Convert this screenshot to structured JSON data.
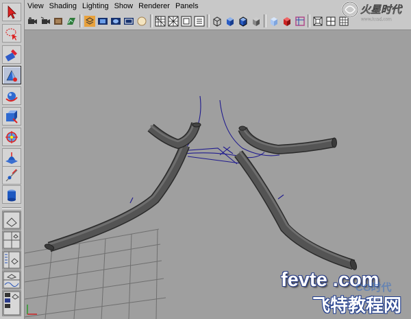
{
  "menu": {
    "items": [
      {
        "label": "View"
      },
      {
        "label": "Shading"
      },
      {
        "label": "Lighting"
      },
      {
        "label": "Show"
      },
      {
        "label": "Renderer"
      },
      {
        "label": "Panels"
      }
    ]
  },
  "toolbox": {
    "tools": [
      {
        "name": "select-tool-icon",
        "active": false
      },
      {
        "name": "lasso-tool-icon",
        "active": false
      },
      {
        "name": "paint-select-tool-icon",
        "active": false
      },
      {
        "name": "move-tool-icon",
        "active": true
      },
      {
        "name": "rotate-tool-icon",
        "active": false
      },
      {
        "name": "scale-tool-icon",
        "active": false
      },
      {
        "name": "universal-manipulator-icon",
        "active": false
      },
      {
        "name": "soft-mod-tool-icon",
        "active": false
      },
      {
        "name": "show-manipulator-icon",
        "active": false
      },
      {
        "name": "last-used-tool-icon",
        "active": false
      }
    ]
  },
  "watermark": {
    "site_top": "火星时代",
    "site_top_sub": "www.hxsd.com",
    "brand": "fevte .com",
    "brand_cn": "飞特教程网",
    "brand_cg": "CG时代"
  },
  "colors": {
    "viewport_bg": "#9f9f9f",
    "grid": "#6e6e6e",
    "tube": "#4a4a4a",
    "curve": "#1f1a8e"
  }
}
